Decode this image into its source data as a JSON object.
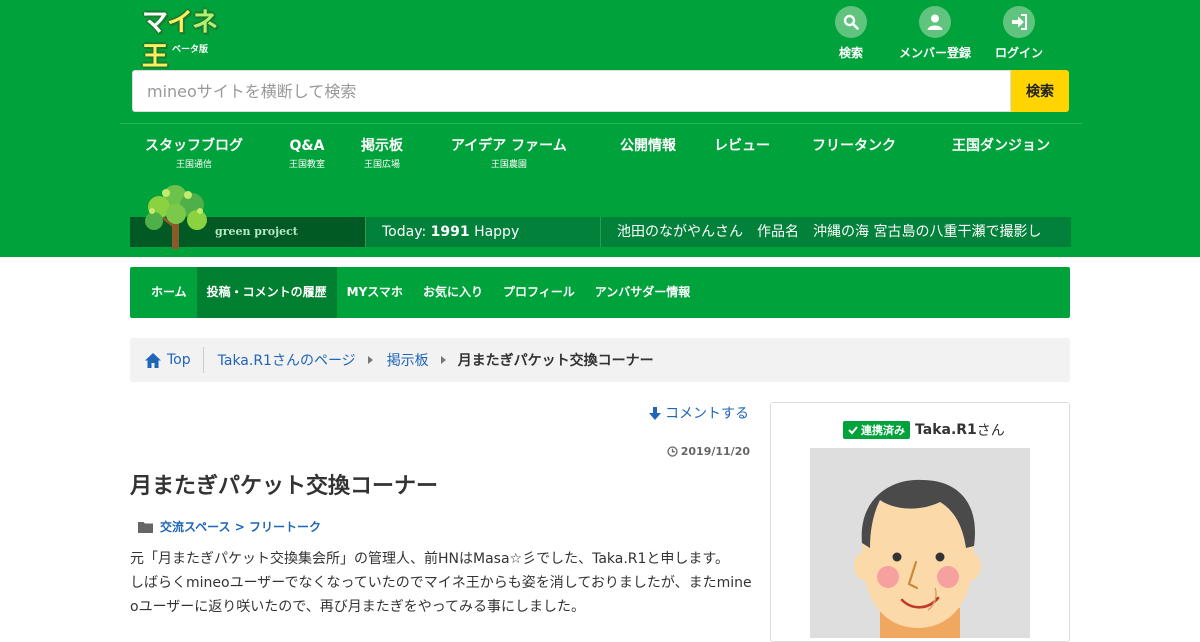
{
  "header": {
    "logo_text": "マイネ王",
    "logo_sub": "ベータ版",
    "icons": [
      {
        "label": "検索",
        "icon": "search-icon"
      },
      {
        "label": "メンバー登録",
        "icon": "user-icon"
      },
      {
        "label": "ログイン",
        "icon": "login-icon"
      }
    ],
    "search": {
      "placeholder": "mineoサイトを横断して検索",
      "button": "検索"
    }
  },
  "gnav": [
    {
      "main": "スタッフブログ",
      "sub": "王国通信"
    },
    {
      "main": "Q&A",
      "sub": "王国教室"
    },
    {
      "main": "掲示板",
      "sub": "王国広場"
    },
    {
      "main": "アイデア ファーム",
      "sub": "王国農園"
    },
    {
      "main": "公開情報",
      "sub": ""
    },
    {
      "main": "レビュー",
      "sub": ""
    },
    {
      "main": "フリータンク",
      "sub": ""
    },
    {
      "main": "王国ダンジョン",
      "sub": ""
    }
  ],
  "ticker": {
    "brand": "green project",
    "today_label": "Today:",
    "today_count": "1991",
    "today_suffix": "Happy",
    "news": "池田のながやんさん　作品名　沖縄の海 宮古島の八重干瀬で撮影し"
  },
  "mynav": [
    {
      "label": "ホーム",
      "active": false
    },
    {
      "label": "投稿・コメントの履歴",
      "active": true
    },
    {
      "label": "MYスマホ",
      "active": false
    },
    {
      "label": "お気に入り",
      "active": false
    },
    {
      "label": "プロフィール",
      "active": false
    },
    {
      "label": "アンバサダー情報",
      "active": false
    }
  ],
  "breadcrumb": {
    "top": "Top",
    "items": [
      "Taka.R1さんのページ",
      "掲示板"
    ],
    "current": "月またぎパケット交換コーナー"
  },
  "post": {
    "comment_link": "コメントする",
    "date": "2019/11/20",
    "title": "月またぎパケット交換コーナー",
    "category": "交流スペース > フリートーク",
    "body": [
      "元「月またぎパケット交換集会所」の管理人、前HNはMasa☆彡でした、Taka.R1と申します。",
      "しばらくmineoユーザーでなくなっていたのでマイネ王からも姿を消しておりましたが、またmineoユーザーに返り咲いたので、再び月またぎをやってみる事にしました。"
    ]
  },
  "sidebar": {
    "badge": "連携済み",
    "username": "Taka.R1",
    "suffix": "さん"
  },
  "colors": {
    "brand_green": "#00a23b",
    "dark_green": "#01813a",
    "search_yellow": "#ffd400",
    "link_blue": "#1f65b8"
  }
}
